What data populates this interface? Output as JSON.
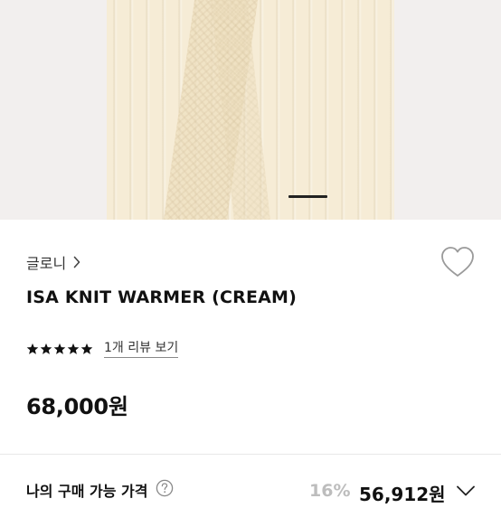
{
  "product": {
    "brand": "글로니",
    "title": "ISA KNIT WARMER (CREAM)",
    "rating_stars": 5,
    "review_link": "1개 리뷰 보기",
    "price": "68,000원"
  },
  "purchase": {
    "label": "나의 구매 가능 가격",
    "discount": "16%",
    "final_price": "56,912원"
  },
  "icons": [
    "chevron-right-icon",
    "heart-icon",
    "star-icon",
    "help-icon",
    "chevron-down-icon"
  ],
  "colors": {
    "knit": "#f6ecd6",
    "discount_gray": "#bdbdbd",
    "text": "#111111"
  }
}
